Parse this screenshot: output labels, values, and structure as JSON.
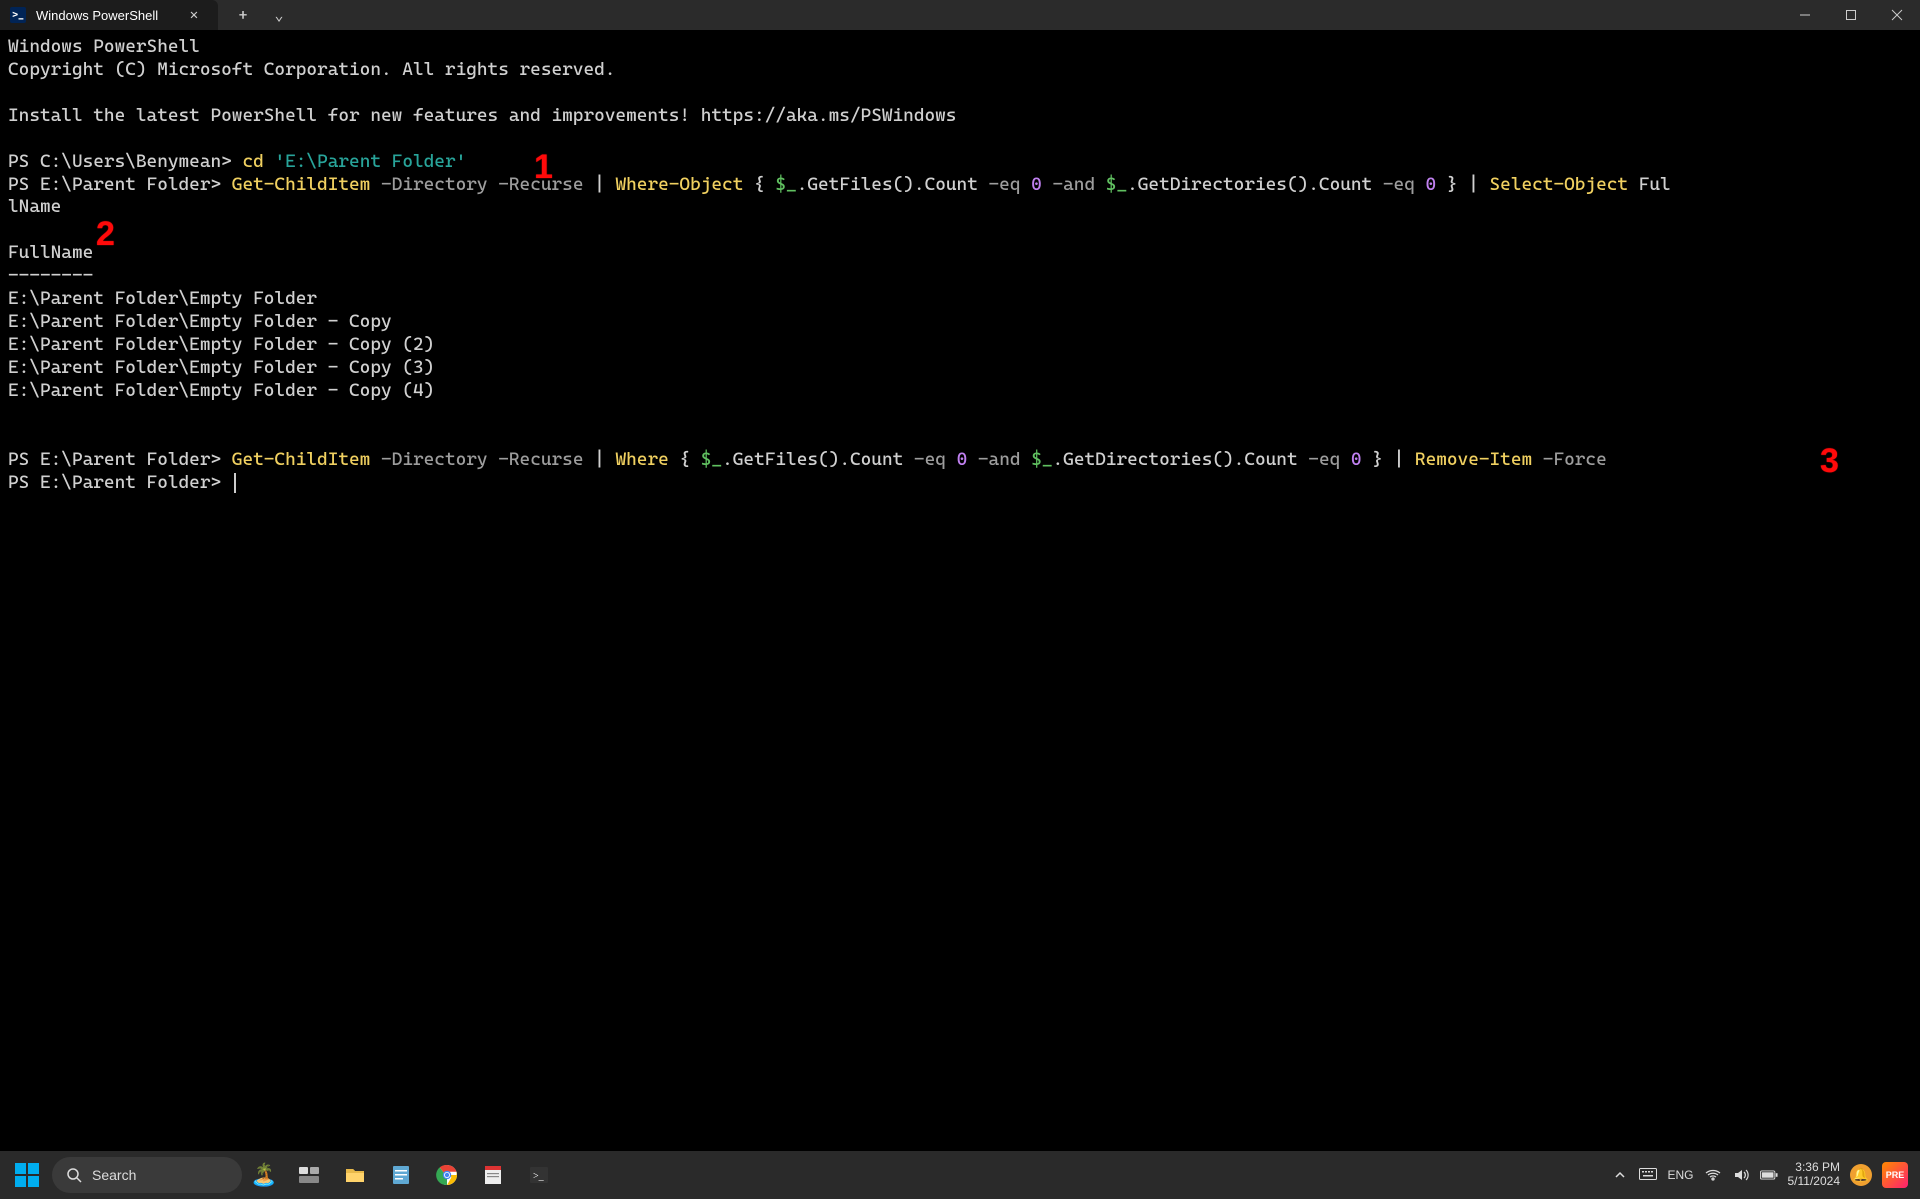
{
  "titlebar": {
    "tab_title": "Windows PowerShell",
    "new_tab_tooltip": "+",
    "dropdown_tooltip": "⌄"
  },
  "terminal": {
    "header_line1": "Windows PowerShell",
    "header_line2": "Copyright (C) Microsoft Corporation. All rights reserved.",
    "install_hint": "Install the latest PowerShell for new features and improvements! https://aka.ms/PSWindows",
    "prompt1_prefix": "PS C:\\Users\\Benymean> ",
    "prompt1_cmd": "cd ",
    "prompt1_arg": "'E:\\Parent Folder'",
    "prompt2_prefix": "PS E:\\Parent Folder> ",
    "cmd2_tokens": {
      "cmdlet": "Get-ChildItem",
      "p_dir": " -Directory",
      "p_rec": " -Recurse",
      "pipe1": " | ",
      "where": "Where-Object",
      "brace_open": " { ",
      "var1": "$_",
      "getfiles": ".GetFiles().Count ",
      "eq1": "-eq",
      "zero1": " 0 ",
      "and": "-and",
      "var2": " $_",
      "getdirs": ".GetDirectories().Count ",
      "eq2": "-eq",
      "zero2": " 0 ",
      "brace_close": "}",
      "pipe2": " | ",
      "select": "Select-Object",
      "fullname_wrap_a": " Ful",
      "fullname_wrap_b": "lName"
    },
    "output_header": "FullName",
    "output_dashes": "--------",
    "output_rows": [
      "E:\\Parent Folder\\Empty Folder",
      "E:\\Parent Folder\\Empty Folder - Copy",
      "E:\\Parent Folder\\Empty Folder - Copy (2)",
      "E:\\Parent Folder\\Empty Folder - Copy (3)",
      "E:\\Parent Folder\\Empty Folder - Copy (4)"
    ],
    "prompt3_prefix": "PS E:\\Parent Folder> ",
    "cmd3_tokens": {
      "cmdlet": "Get-ChildItem",
      "p_dir": " -Directory",
      "p_rec": " -Recurse",
      "pipe1": " | ",
      "where": "Where",
      "brace_open": " { ",
      "var1": "$_",
      "getfiles": ".GetFiles().Count ",
      "eq1": "-eq",
      "zero1": " 0 ",
      "and": "-and",
      "var2": " $_",
      "getdirs": ".GetDirectories().Count ",
      "eq2": "-eq",
      "zero2": " 0 ",
      "brace_close": "}",
      "pipe2": " | ",
      "remove": "Remove-Item",
      "force": " -Force"
    },
    "prompt4_prefix": "PS E:\\Parent Folder> "
  },
  "annotations": {
    "a1": "1",
    "a2": "2",
    "a3": "3"
  },
  "taskbar": {
    "search_placeholder": "Search",
    "language": "ENG",
    "time": "3:36 PM",
    "date": "5/11/2024",
    "pre_label": "PRE"
  }
}
